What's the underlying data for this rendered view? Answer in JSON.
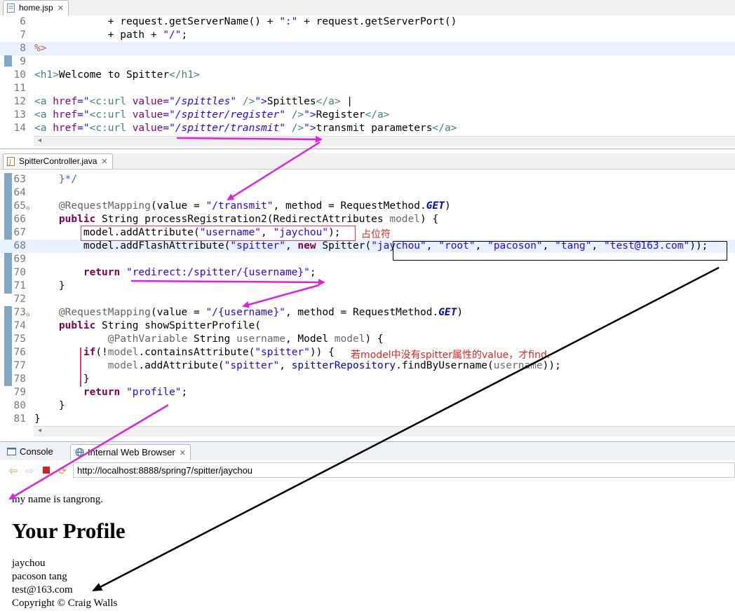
{
  "tabs": {
    "home": "home.jsp",
    "controller": "SpitterController.java",
    "close": "✕"
  },
  "home_lines": {
    "n6": "6",
    "n7": "7",
    "n8": "8",
    "n9": "9",
    "n10": "10",
    "n11": "11",
    "n12": "12",
    "n13": "13",
    "n14": "14",
    "l6a": "            + request.getServerName() + ",
    "l6b": "\":\"",
    "l6c": " + request.getServerPort()",
    "l7a": "            + path + ",
    "l7b": "\"/\"",
    "l7c": ";",
    "l8": "%>",
    "l10a": "<h1>",
    "l10b": "Welcome to Spitter",
    "l10c": "</h1>",
    "l12a": "<a ",
    "l12b": "href",
    "l12c": "=\"",
    "l12d": "<c:url ",
    "l12e": "value",
    "l12f": "=\"/spittles\"",
    "l12g": " />",
    "l12h": "\">",
    "l12i": "Spittles",
    "l12j": "</a>",
    "l12k": " |",
    "l13a": "<a ",
    "l13b": "href",
    "l13c": "=\"",
    "l13d": "<c:url ",
    "l13e": "value",
    "l13f": "=\"/spitter/register\"",
    "l13g": " />",
    "l13h": "\">",
    "l13i": "Register",
    "l13j": "</a>",
    "l14a": "<a ",
    "l14b": "href",
    "l14c": "=\"",
    "l14d": "<c:url ",
    "l14e": "value",
    "l14f": "=\"/spitter/transmit\"",
    "l14g": " />",
    "l14h": "\">",
    "l14i": "transmit parameters",
    "l14j": "</a>"
  },
  "java_lines": {
    "n63": "63",
    "n64": "64",
    "n65": "65",
    "n66": "66",
    "n67": "67",
    "n68": "68",
    "n69": "69",
    "n70": "70",
    "n71": "71",
    "n72": "72",
    "n73": "73",
    "n74": "74",
    "n75": "75",
    "n76": "76",
    "n77": "77",
    "n78": "78",
    "n79": "79",
    "n80": "80",
    "n81": "81",
    "l63": "    }*/",
    "l65a": "    @RequestMapping",
    "l65b": "(value = ",
    "l65c": "\"/transmit\"",
    "l65d": ", method = RequestMethod.",
    "l65e": "GET",
    "l65f": ")",
    "l66a": "    ",
    "l66b": "public",
    "l66c": " String processRegistration2(RedirectAttributes ",
    "l66d": "model",
    "l66e": ") {",
    "l67a": "        model.addAttribute(",
    "l67b": "\"username\"",
    "l67c": ", ",
    "l67d": "\"jaychou\"",
    "l67e": ");",
    "l68a": "        model.addFlashAttribute(",
    "l68b": "\"spitter\"",
    "l68c": ", ",
    "l68d": "new",
    "l68e": " Spitter(",
    "l68f": "\"jaychou\"",
    "l68g": ", ",
    "l68h": "\"root\"",
    "l68i": ", ",
    "l68j": "\"pacoson\"",
    "l68k": ", ",
    "l68l": "\"tang\"",
    "l68m": ", ",
    "l68n": "\"test@163.com\"",
    "l68o": "));",
    "l70a": "        ",
    "l70b": "return",
    "l70c": " ",
    "l70d": "\"redirect:/spitter/{username}\"",
    "l70e": ";",
    "l71": "    }",
    "l73a": "    @RequestMapping",
    "l73b": "(value = ",
    "l73c": "\"/{username}\"",
    "l73d": ", method = RequestMethod.",
    "l73e": "GET",
    "l73f": ")",
    "l74a": "    ",
    "l74b": "public",
    "l74c": " String showSpitterProfile(",
    "l75a": "            @PathVariable",
    "l75b": " String ",
    "l75c": "username",
    "l75d": ", Model ",
    "l75e": "model",
    "l75f": ") {",
    "l76a": "        ",
    "l76b": "if",
    "l76c": "(!",
    "l76d": "model",
    "l76e": ".containsAttribute(",
    "l76f": "\"spitter\"",
    "l76g": ")) {",
    "l77a": "            ",
    "l77b": "model",
    "l77c": ".addAttribute(",
    "l77d": "\"spitter\"",
    "l77e": ", ",
    "l77f": "spitterRepository",
    "l77g": ".findByUsername(",
    "l77h": "username",
    "l77i": "));",
    "l78": "        }",
    "l79a": "        ",
    "l79b": "return",
    "l79c": " ",
    "l79d": "\"profile\"",
    "l79e": ";",
    "l80": "    }",
    "l81": "}"
  },
  "annotations": {
    "placeholder_note": "占位符",
    "find_note": "若model中没有spitter属性的value，才find."
  },
  "bottom_tabs": {
    "console": "Console",
    "browser": "Internal Web Browser",
    "close": "✕"
  },
  "browser": {
    "url": "http://localhost:8888/spring7/spitter/jaychou",
    "back_icon": "arrow-left-icon",
    "forward_icon": "arrow-right-icon",
    "stop_icon": "stop-icon",
    "refresh_icon": "refresh-icon",
    "greeting": "my name is tangrong.",
    "heading": "Your Profile",
    "username": "jaychou",
    "name": "pacoson tang",
    "email": "test@163.com",
    "copyright": "Copyright © Craig Walls"
  },
  "colors": {
    "arrow_magenta": "#e020e0",
    "arrow_black": "#000000",
    "note_red": "#e0251f"
  }
}
